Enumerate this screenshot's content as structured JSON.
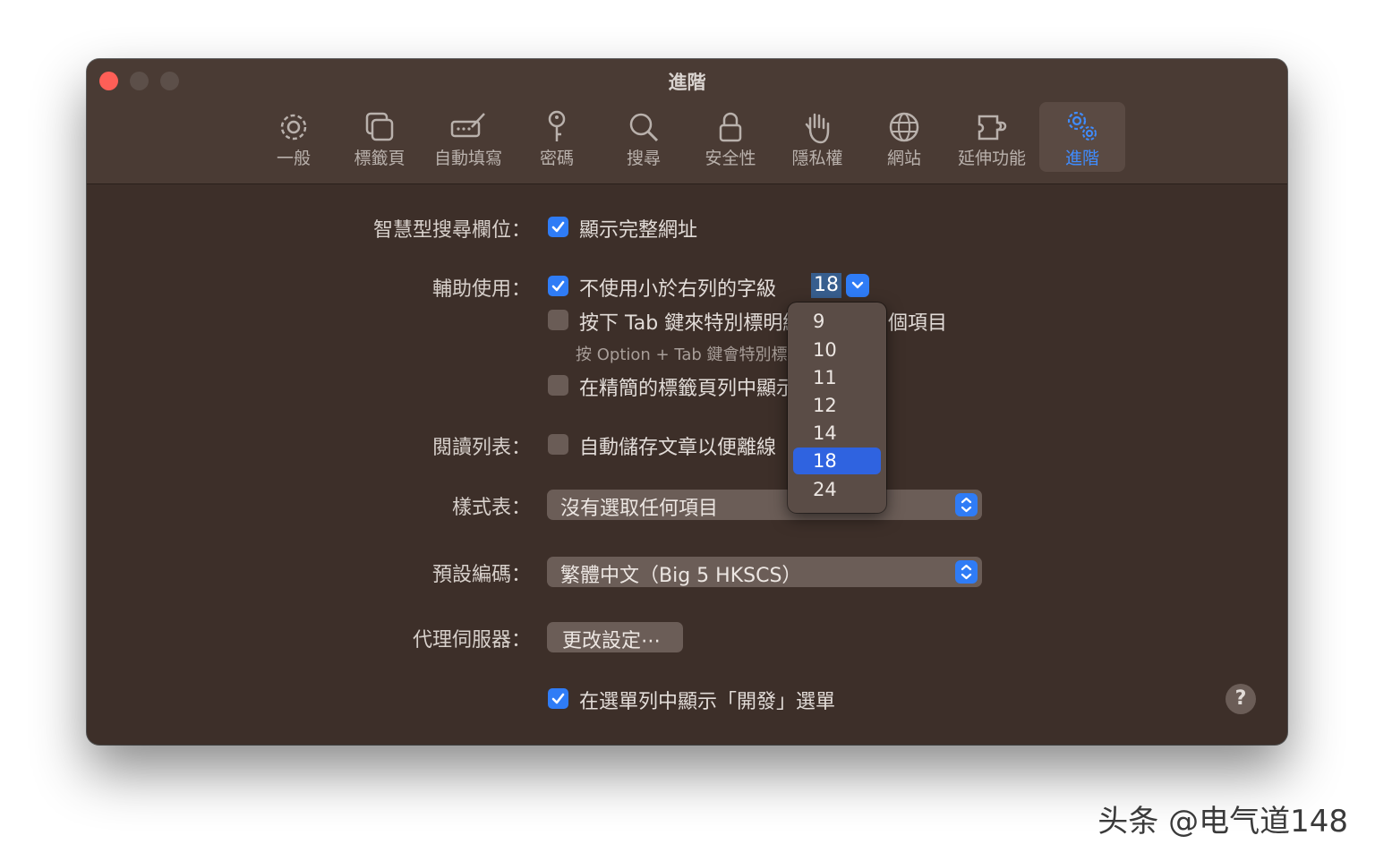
{
  "window": {
    "title": "進階"
  },
  "toolbar": {
    "items": [
      {
        "label": "一般",
        "icon": "gear-icon"
      },
      {
        "label": "標籤頁",
        "icon": "tabs-icon"
      },
      {
        "label": "自動填寫",
        "icon": "autofill-icon"
      },
      {
        "label": "密碼",
        "icon": "key-icon"
      },
      {
        "label": "搜尋",
        "icon": "search-icon"
      },
      {
        "label": "安全性",
        "icon": "lock-icon"
      },
      {
        "label": "隱私權",
        "icon": "hand-icon"
      },
      {
        "label": "網站",
        "icon": "globe-icon"
      },
      {
        "label": "延伸功能",
        "icon": "puzzle-icon"
      },
      {
        "label": "進階",
        "icon": "gears-icon",
        "active": true
      }
    ]
  },
  "smart_search": {
    "label": "智慧型搜尋欄位：",
    "show_full_url": {
      "text": "顯示完整網址",
      "checked": true
    }
  },
  "accessibility": {
    "label": "輔助使用：",
    "min_font": {
      "text": "不使用小於右列的字級",
      "checked": true,
      "value": "18"
    },
    "tab_highlight": {
      "text_left": "按下 Tab 鍵來特別標明網",
      "text_right": "個項目",
      "checked": false
    },
    "tab_hint": "按 Option + Tab 鍵會特別標",
    "compact_tabs": {
      "text": "在精簡的標籤頁列中顯示",
      "checked": false
    }
  },
  "font_size_menu": {
    "options": [
      "9",
      "10",
      "11",
      "12",
      "14",
      "18",
      "24"
    ],
    "selected": "18"
  },
  "reading_list": {
    "label": "閱讀列表：",
    "auto_save": {
      "text": "自動儲存文章以便離線",
      "checked": false
    }
  },
  "stylesheet": {
    "label": "樣式表：",
    "value": "沒有選取任何項目"
  },
  "encoding": {
    "label": "預設編碼：",
    "value": "繁體中文（Big 5 HKSCS）"
  },
  "proxy": {
    "label": "代理伺服器：",
    "button": "更改設定⋯"
  },
  "develop_menu": {
    "text": "在選單列中顯示「開發」選單",
    "checked": true
  },
  "help": {
    "label": "?"
  },
  "watermark": {
    "text": "头条 @电气道148"
  },
  "colors": {
    "accent": "#2f7cf6",
    "background": "#3d2f29",
    "close": "#fe5f57"
  }
}
